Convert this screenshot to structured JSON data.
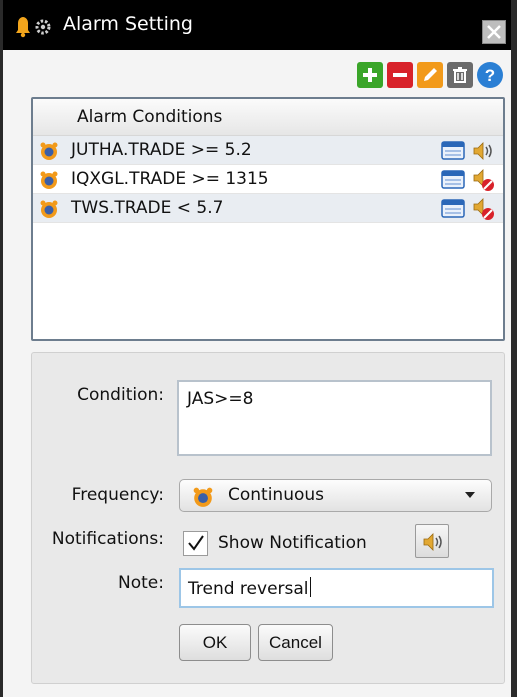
{
  "window": {
    "title": "Alarm Setting",
    "close_icon": "close-icon"
  },
  "toolbar": {
    "buttons": [
      {
        "name": "add",
        "icon": "plus-icon",
        "color": "#3aa529"
      },
      {
        "name": "remove",
        "icon": "minus-icon",
        "color": "#d8222a"
      },
      {
        "name": "edit",
        "icon": "pencil-icon",
        "color": "#f29a1a"
      },
      {
        "name": "delete",
        "icon": "trash-icon",
        "color": "#6b6b6b"
      },
      {
        "name": "help",
        "icon": "question-icon",
        "color": "#2a7fd4"
      }
    ]
  },
  "list": {
    "header": "Alarm Conditions",
    "rows": [
      {
        "text": "JUTHA.TRADE >= 5.2",
        "sound_muted": false
      },
      {
        "text": "IQXGL.TRADE >= 1315",
        "sound_muted": true
      },
      {
        "text": "TWS.TRADE < 5.7",
        "sound_muted": true
      }
    ]
  },
  "form": {
    "condition_label": "Condition:",
    "condition_value": "JAS>=8",
    "frequency_label": "Frequency:",
    "frequency_value": "Continuous",
    "notifications_label": "Notifications:",
    "show_notification_label": "Show Notification",
    "show_notification_checked": true,
    "note_label": "Note:",
    "note_value": "Trend reversal",
    "ok_label": "OK",
    "cancel_label": "Cancel"
  },
  "colors": {
    "titlebar": "#000000",
    "selected_row": "#e9edf2",
    "note_focus_border": "#9dc6e7"
  }
}
